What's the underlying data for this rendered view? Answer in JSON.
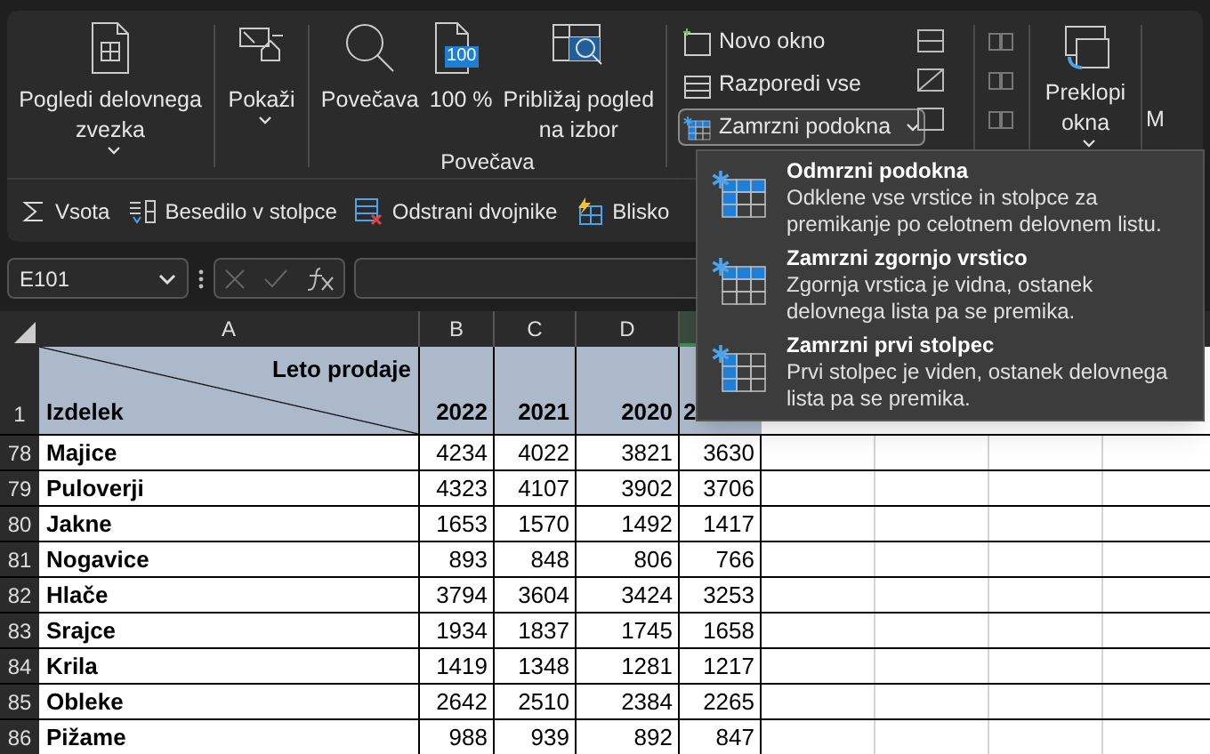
{
  "ribbon": {
    "workbook_views": {
      "label": "Pogledi delovnega\nzvezka",
      "has_dropdown": true
    },
    "show": {
      "label": "Pokaži",
      "has_dropdown": true
    },
    "zoom_group": {
      "label": "Povečava",
      "buttons": [
        {
          "label": "Povečava"
        },
        {
          "label": "100 %",
          "icon_text": "100"
        },
        {
          "label": "Približaj pogled\nna izbor"
        }
      ]
    },
    "window_buttons": [
      {
        "label": "Novo okno",
        "active": false,
        "has_dropdown": false
      },
      {
        "label": "Razporedi vse",
        "active": false,
        "has_dropdown": false
      },
      {
        "label": "Zamrzni podokna",
        "active": true,
        "has_dropdown": true
      }
    ],
    "switch_windows": {
      "label": "Preklopi\nokna",
      "has_dropdown": true
    },
    "cut_label": "M"
  },
  "quick_bar": [
    {
      "label": "Vsota"
    },
    {
      "label": "Besedilo v stolpce"
    },
    {
      "label": "Odstrani dvojnike"
    },
    {
      "label": "Blisko"
    }
  ],
  "name_box": "E101",
  "columns": [
    "A",
    "B",
    "C",
    "D"
  ],
  "header_row": {
    "number": "1",
    "top_label": "Leto prodaje",
    "bottom_label": "Izdelek",
    "years": [
      "2022",
      "2021",
      "2020",
      "2"
    ]
  },
  "rows": [
    {
      "number": "78",
      "name": "Majice",
      "values": [
        "4234",
        "4022",
        "3821",
        "3630"
      ]
    },
    {
      "number": "79",
      "name": "Puloverji",
      "values": [
        "4323",
        "4107",
        "3902",
        "3706"
      ]
    },
    {
      "number": "80",
      "name": "Jakne",
      "values": [
        "1653",
        "1570",
        "1492",
        "1417"
      ]
    },
    {
      "number": "81",
      "name": "Nogavice",
      "values": [
        "893",
        "848",
        "806",
        "766"
      ]
    },
    {
      "number": "82",
      "name": "Hlače",
      "values": [
        "3794",
        "3604",
        "3424",
        "3253"
      ]
    },
    {
      "number": "83",
      "name": "Srajce",
      "values": [
        "1934",
        "1837",
        "1745",
        "1658"
      ]
    },
    {
      "number": "84",
      "name": "Krila",
      "values": [
        "1419",
        "1348",
        "1281",
        "1217"
      ]
    },
    {
      "number": "85",
      "name": "Obleke",
      "values": [
        "2642",
        "2510",
        "2384",
        "2265"
      ]
    },
    {
      "number": "86",
      "name": "Pižame",
      "values": [
        "988",
        "939",
        "892",
        "847"
      ]
    }
  ],
  "freeze_menu": [
    {
      "title": "Odmrzni podokna",
      "description": "Odklene vse vrstice in stolpce za premikanje po celotnem delovnem listu."
    },
    {
      "title": "Zamrzni zgornjo vrstico",
      "description": "Zgornja vrstica je vidna, ostanek delovnega lista pa se premika."
    },
    {
      "title": "Zamrzni prvi stolpec",
      "description": "Prvi stolpec je viden, ostanek delovnega lista pa se premika."
    }
  ]
}
